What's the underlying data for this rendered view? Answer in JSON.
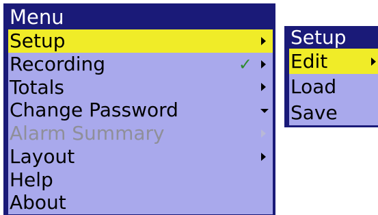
{
  "main_menu": {
    "title": "Menu",
    "items": [
      {
        "label": "Setup",
        "state": "selected",
        "icon": "chevron-right-icon"
      },
      {
        "label": "Recording",
        "state": "normal",
        "checked": true,
        "check_icon": "checkmark-icon",
        "icon": "chevron-right-icon"
      },
      {
        "label": "Totals",
        "state": "normal",
        "icon": "chevron-right-icon"
      },
      {
        "label": "Change Password",
        "state": "normal",
        "icon": "chevron-down-icon"
      },
      {
        "label": "Alarm Summary",
        "state": "disabled",
        "icon": "chevron-right-icon"
      },
      {
        "label": "Layout",
        "state": "normal",
        "icon": "chevron-right-icon"
      },
      {
        "label": "Help",
        "state": "normal"
      },
      {
        "label": "About",
        "state": "normal"
      }
    ]
  },
  "setup_submenu": {
    "title": "Setup",
    "items": [
      {
        "label": "Edit",
        "state": "selected",
        "icon": "chevron-right-icon"
      },
      {
        "label": "Load",
        "state": "normal"
      },
      {
        "label": "Save",
        "state": "normal"
      }
    ]
  },
  "colors": {
    "panel_border": "#1a1a78",
    "menu_background": "#a9a9ec",
    "selection_highlight": "#f0ec28",
    "title_text": "#ffffff",
    "disabled_text": "#8f8f99",
    "checkmark": "#2e8b2e"
  }
}
